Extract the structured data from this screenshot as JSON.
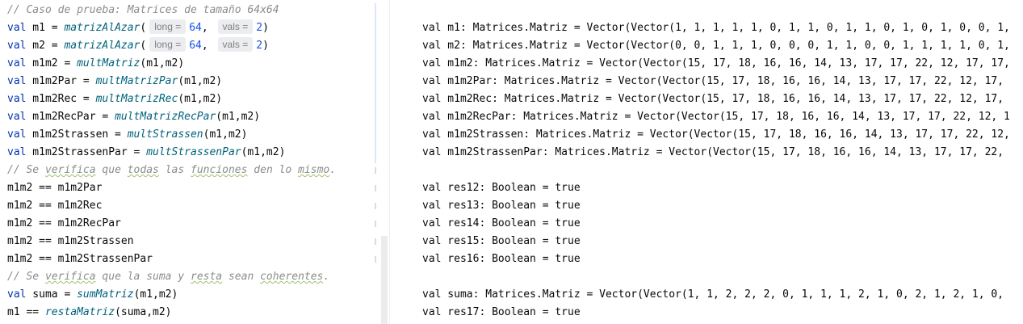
{
  "editor": {
    "lines": [
      {
        "segments": [
          {
            "t": "// Caso de prueba: Matrices de tamaño 64x64",
            "c": "cm"
          }
        ]
      },
      {
        "segments": [
          {
            "t": "val",
            "c": "kw"
          },
          {
            "t": " m1 = "
          },
          {
            "t": "matrizAlAzar",
            "c": "fn"
          },
          {
            "t": "("
          },
          {
            "t": "long =",
            "c": "hint"
          },
          {
            "t": "64",
            "c": "num"
          },
          {
            "t": ", "
          },
          {
            "t": "vals =",
            "c": "hint"
          },
          {
            "t": "2",
            "c": "num"
          },
          {
            "t": ")"
          }
        ]
      },
      {
        "segments": [
          {
            "t": "val",
            "c": "kw"
          },
          {
            "t": " m2 = "
          },
          {
            "t": "matrizAlAzar",
            "c": "fn"
          },
          {
            "t": "("
          },
          {
            "t": "long =",
            "c": "hint"
          },
          {
            "t": "64",
            "c": "num"
          },
          {
            "t": ", "
          },
          {
            "t": "vals =",
            "c": "hint"
          },
          {
            "t": "2",
            "c": "num"
          },
          {
            "t": ")"
          }
        ]
      },
      {
        "segments": [
          {
            "t": "val",
            "c": "kw"
          },
          {
            "t": " m1m2 = "
          },
          {
            "t": "multMatriz",
            "c": "fn"
          },
          {
            "t": "(m1,m2)"
          }
        ]
      },
      {
        "segments": [
          {
            "t": "val",
            "c": "kw"
          },
          {
            "t": " m1m2Par = "
          },
          {
            "t": "multMatrizPar",
            "c": "fn"
          },
          {
            "t": "(m1,m2)"
          }
        ]
      },
      {
        "segments": [
          {
            "t": "val",
            "c": "kw"
          },
          {
            "t": " m1m2Rec = "
          },
          {
            "t": "multMatrizRec",
            "c": "fn"
          },
          {
            "t": "(m1,m2)"
          }
        ]
      },
      {
        "segments": [
          {
            "t": "val",
            "c": "kw"
          },
          {
            "t": " m1m2RecPar = "
          },
          {
            "t": "multMatrizRecPar",
            "c": "fn"
          },
          {
            "t": "(m1,m2)"
          }
        ]
      },
      {
        "segments": [
          {
            "t": "val",
            "c": "kw"
          },
          {
            "t": " m1m2Strassen = "
          },
          {
            "t": "multStrassen",
            "c": "fn"
          },
          {
            "t": "(m1,m2)"
          }
        ]
      },
      {
        "segments": [
          {
            "t": "val",
            "c": "kw"
          },
          {
            "t": " m1m2StrassenPar = "
          },
          {
            "t": "multStrassenPar",
            "c": "fn"
          },
          {
            "t": "(m1,m2)"
          }
        ]
      },
      {
        "segments": [
          {
            "t": "// Se ",
            "c": "cm"
          },
          {
            "t": "verifica",
            "c": "cm uw"
          },
          {
            "t": " que ",
            "c": "cm"
          },
          {
            "t": "todas",
            "c": "cm uw"
          },
          {
            "t": " las ",
            "c": "cm"
          },
          {
            "t": "funciones",
            "c": "cm uw"
          },
          {
            "t": " den lo ",
            "c": "cm"
          },
          {
            "t": "mismo",
            "c": "cm uw"
          },
          {
            "t": ".",
            "c": "cm"
          }
        ]
      },
      {
        "segments": [
          {
            "t": "m1m2 == m1m2Par"
          }
        ]
      },
      {
        "segments": [
          {
            "t": "m1m2 == m1m2Rec"
          }
        ]
      },
      {
        "segments": [
          {
            "t": "m1m2 == m1m2RecPar"
          }
        ]
      },
      {
        "segments": [
          {
            "t": "m1m2 == m1m2Strassen"
          }
        ]
      },
      {
        "segments": [
          {
            "t": "m1m2 == m1m2StrassenPar"
          }
        ]
      },
      {
        "segments": [
          {
            "t": "// Se ",
            "c": "cm"
          },
          {
            "t": "verifica",
            "c": "cm uw"
          },
          {
            "t": " que la suma y ",
            "c": "cm"
          },
          {
            "t": "resta",
            "c": "cm uw"
          },
          {
            "t": " sean ",
            "c": "cm"
          },
          {
            "t": "coherentes",
            "c": "cm uw"
          },
          {
            "t": ".",
            "c": "cm"
          }
        ]
      },
      {
        "segments": [
          {
            "t": "val",
            "c": "kw"
          },
          {
            "t": " suma = "
          },
          {
            "t": "sumMatriz",
            "c": "fn"
          },
          {
            "t": "(m1,m2)"
          }
        ]
      },
      {
        "segments": [
          {
            "t": "m1 == "
          },
          {
            "t": "restaMatriz",
            "c": "fn"
          },
          {
            "t": "(suma,m2)"
          }
        ]
      }
    ]
  },
  "results": {
    "lines": [
      "",
      "val m1: Matrices.Matriz = Vector(Vector(1, 1, 1, 1, 1, 0, 1, 1, 0, 1, 1, 0, 1, 0, 1, 0, 0, 1,",
      "val m2: Matrices.Matriz = Vector(Vector(0, 0, 1, 1, 1, 0, 0, 0, 1, 1, 0, 0, 1, 1, 1, 1, 0, 1,",
      "val m1m2: Matrices.Matriz = Vector(Vector(15, 17, 18, 16, 16, 14, 13, 17, 17, 22, 12, 17, 17,",
      "val m1m2Par: Matrices.Matriz = Vector(Vector(15, 17, 18, 16, 16, 14, 13, 17, 17, 22, 12, 17,",
      "val m1m2Rec: Matrices.Matriz = Vector(Vector(15, 17, 18, 16, 16, 14, 13, 17, 17, 22, 12, 17,",
      "val m1m2RecPar: Matrices.Matriz = Vector(Vector(15, 17, 18, 16, 16, 14, 13, 17, 17, 22, 12, 1",
      "val m1m2Strassen: Matrices.Matriz = Vector(Vector(15, 17, 18, 16, 16, 14, 13, 17, 17, 22, 12,",
      "val m1m2StrassenPar: Matrices.Matriz = Vector(Vector(15, 17, 18, 16, 16, 14, 13, 17, 17, 22,",
      "",
      "val res12: Boolean = true",
      "val res13: Boolean = true",
      "val res14: Boolean = true",
      "val res15: Boolean = true",
      "val res16: Boolean = true",
      "",
      "val suma: Matrices.Matriz = Vector(Vector(1, 1, 2, 2, 2, 0, 1, 1, 1, 2, 1, 0, 2, 1, 2, 1, 0,",
      "val res17: Boolean = true"
    ]
  }
}
